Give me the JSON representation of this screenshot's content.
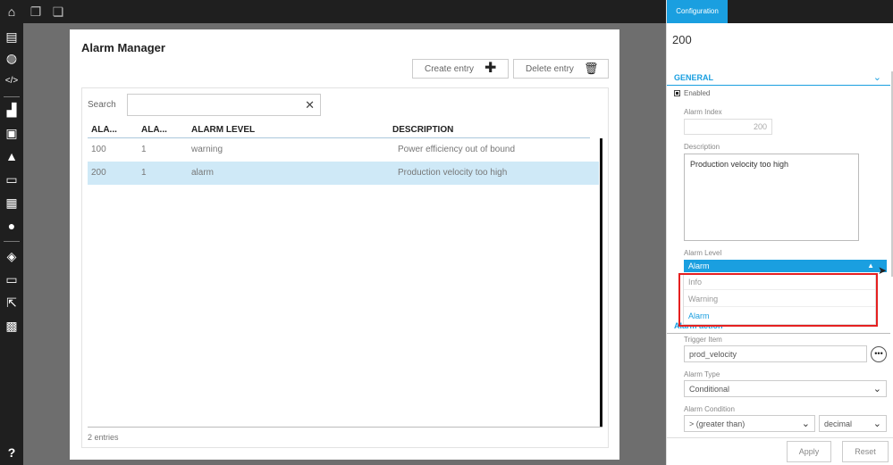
{
  "topbar": {
    "icons": [
      "home-icon",
      "copy-icon",
      "paste-icon"
    ]
  },
  "sidebar": {
    "icons": [
      "panel-icon",
      "globe-settings-icon",
      "code-icon",
      "factory-icon",
      "chart-icon",
      "warning-icon",
      "card-icon",
      "list-icon",
      "user-icon",
      "box-icon",
      "display-settings-icon",
      "export-icon",
      "grid-icon",
      "help-icon"
    ]
  },
  "card": {
    "title": "Alarm Manager",
    "create_label": "Create entry",
    "delete_label": "Delete entry",
    "search_label": "Search",
    "search_value": "",
    "columns": [
      "ALA...",
      "ALA...",
      "ALARM LEVEL",
      "DESCRIPTION"
    ],
    "rows": [
      {
        "c1": "100",
        "c2": "1",
        "level": "warning",
        "desc": "Power efficiency out of bound"
      },
      {
        "c1": "200",
        "c2": "1",
        "level": "alarm",
        "desc": "Production velocity too high"
      }
    ],
    "selected_row": 1,
    "footer": "2 entries"
  },
  "panel": {
    "tab": "Configuration",
    "id": "200",
    "general": "GENERAL",
    "enabled_label": "Enabled",
    "index_label": "Alarm Index",
    "index_value": "200",
    "desc_label": "Description",
    "desc_value": "Production velocity too high",
    "level_label": "Alarm Level",
    "level_value": "Alarm",
    "level_options": [
      "Info",
      "Warning",
      "Alarm"
    ],
    "section2": "Alarm action",
    "trigger_label": "Trigger Item",
    "trigger_value": "prod_velocity",
    "type_label": "Alarm Type",
    "type_value": "Conditional",
    "cond_label": "Alarm Condition",
    "cond_value": "> (greater than)",
    "cond_type": "decimal",
    "apply": "Apply",
    "reset": "Reset"
  },
  "colors": {
    "accent": "#1a9fe0",
    "highlight": "#e52020",
    "selected_row": "#cfe9f7"
  }
}
